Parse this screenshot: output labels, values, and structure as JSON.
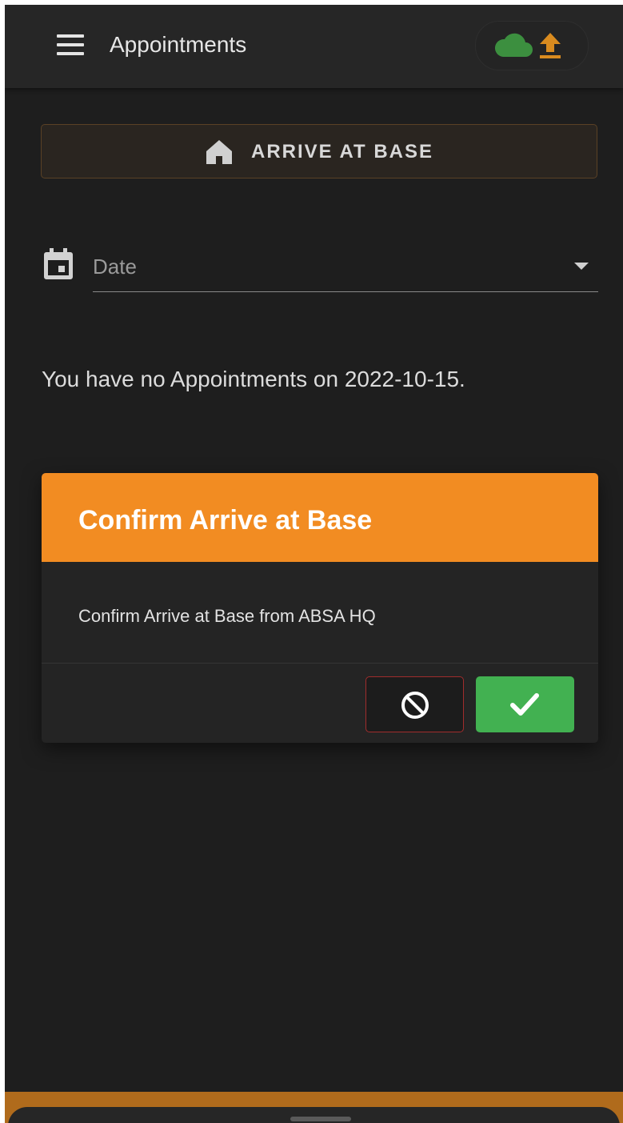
{
  "appbar": {
    "title": "Appointments",
    "menu_icon": "hamburger-menu-icon",
    "sync_icons": [
      "cloud-icon",
      "upload-arrow-icon"
    ],
    "cloud_color": "#3c8f3f",
    "upload_color": "#d98b1f"
  },
  "arrive_button": {
    "label": "ARRIVE AT BASE",
    "icon": "home-icon"
  },
  "date_field": {
    "icon": "calendar-icon",
    "placeholder": "Date",
    "value": ""
  },
  "empty_message": "You have no Appointments on 2022-10-15.",
  "dialog": {
    "title": "Confirm Arrive at Base",
    "body": "Confirm Arrive at Base from ABSA HQ",
    "header_color": "#f28c22",
    "cancel_icon": "block-icon",
    "confirm_icon": "check-icon",
    "cancel_border_color": "#a12c2c",
    "confirm_color": "#42b151"
  },
  "colors": {
    "background": "#1e1e1e",
    "appbar": "#262626",
    "accent_orange": "#b06b1c"
  }
}
